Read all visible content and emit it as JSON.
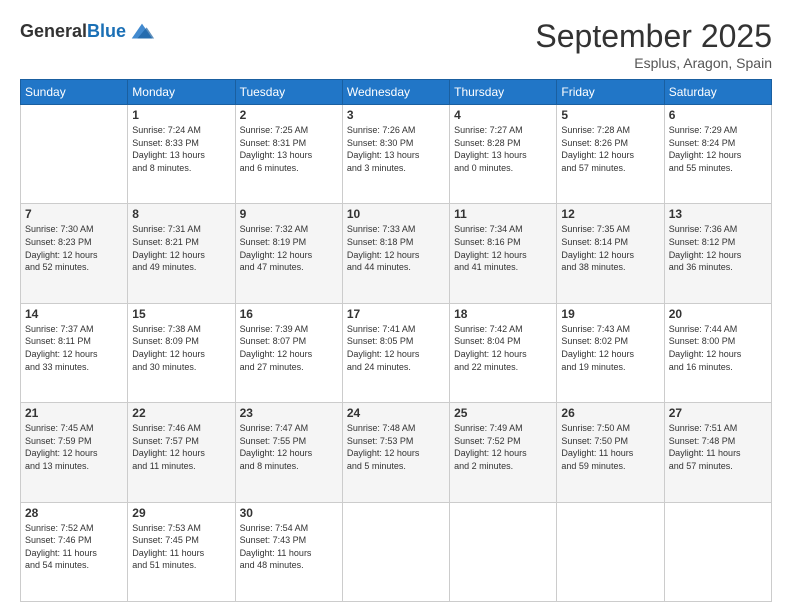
{
  "header": {
    "logo_general": "General",
    "logo_blue": "Blue",
    "month": "September 2025",
    "location": "Esplus, Aragon, Spain"
  },
  "weekdays": [
    "Sunday",
    "Monday",
    "Tuesday",
    "Wednesday",
    "Thursday",
    "Friday",
    "Saturday"
  ],
  "weeks": [
    [
      {
        "day": "",
        "text": ""
      },
      {
        "day": "1",
        "text": "Sunrise: 7:24 AM\nSunset: 8:33 PM\nDaylight: 13 hours\nand 8 minutes."
      },
      {
        "day": "2",
        "text": "Sunrise: 7:25 AM\nSunset: 8:31 PM\nDaylight: 13 hours\nand 6 minutes."
      },
      {
        "day": "3",
        "text": "Sunrise: 7:26 AM\nSunset: 8:30 PM\nDaylight: 13 hours\nand 3 minutes."
      },
      {
        "day": "4",
        "text": "Sunrise: 7:27 AM\nSunset: 8:28 PM\nDaylight: 13 hours\nand 0 minutes."
      },
      {
        "day": "5",
        "text": "Sunrise: 7:28 AM\nSunset: 8:26 PM\nDaylight: 12 hours\nand 57 minutes."
      },
      {
        "day": "6",
        "text": "Sunrise: 7:29 AM\nSunset: 8:24 PM\nDaylight: 12 hours\nand 55 minutes."
      }
    ],
    [
      {
        "day": "7",
        "text": "Sunrise: 7:30 AM\nSunset: 8:23 PM\nDaylight: 12 hours\nand 52 minutes."
      },
      {
        "day": "8",
        "text": "Sunrise: 7:31 AM\nSunset: 8:21 PM\nDaylight: 12 hours\nand 49 minutes."
      },
      {
        "day": "9",
        "text": "Sunrise: 7:32 AM\nSunset: 8:19 PM\nDaylight: 12 hours\nand 47 minutes."
      },
      {
        "day": "10",
        "text": "Sunrise: 7:33 AM\nSunset: 8:18 PM\nDaylight: 12 hours\nand 44 minutes."
      },
      {
        "day": "11",
        "text": "Sunrise: 7:34 AM\nSunset: 8:16 PM\nDaylight: 12 hours\nand 41 minutes."
      },
      {
        "day": "12",
        "text": "Sunrise: 7:35 AM\nSunset: 8:14 PM\nDaylight: 12 hours\nand 38 minutes."
      },
      {
        "day": "13",
        "text": "Sunrise: 7:36 AM\nSunset: 8:12 PM\nDaylight: 12 hours\nand 36 minutes."
      }
    ],
    [
      {
        "day": "14",
        "text": "Sunrise: 7:37 AM\nSunset: 8:11 PM\nDaylight: 12 hours\nand 33 minutes."
      },
      {
        "day": "15",
        "text": "Sunrise: 7:38 AM\nSunset: 8:09 PM\nDaylight: 12 hours\nand 30 minutes."
      },
      {
        "day": "16",
        "text": "Sunrise: 7:39 AM\nSunset: 8:07 PM\nDaylight: 12 hours\nand 27 minutes."
      },
      {
        "day": "17",
        "text": "Sunrise: 7:41 AM\nSunset: 8:05 PM\nDaylight: 12 hours\nand 24 minutes."
      },
      {
        "day": "18",
        "text": "Sunrise: 7:42 AM\nSunset: 8:04 PM\nDaylight: 12 hours\nand 22 minutes."
      },
      {
        "day": "19",
        "text": "Sunrise: 7:43 AM\nSunset: 8:02 PM\nDaylight: 12 hours\nand 19 minutes."
      },
      {
        "day": "20",
        "text": "Sunrise: 7:44 AM\nSunset: 8:00 PM\nDaylight: 12 hours\nand 16 minutes."
      }
    ],
    [
      {
        "day": "21",
        "text": "Sunrise: 7:45 AM\nSunset: 7:59 PM\nDaylight: 12 hours\nand 13 minutes."
      },
      {
        "day": "22",
        "text": "Sunrise: 7:46 AM\nSunset: 7:57 PM\nDaylight: 12 hours\nand 11 minutes."
      },
      {
        "day": "23",
        "text": "Sunrise: 7:47 AM\nSunset: 7:55 PM\nDaylight: 12 hours\nand 8 minutes."
      },
      {
        "day": "24",
        "text": "Sunrise: 7:48 AM\nSunset: 7:53 PM\nDaylight: 12 hours\nand 5 minutes."
      },
      {
        "day": "25",
        "text": "Sunrise: 7:49 AM\nSunset: 7:52 PM\nDaylight: 12 hours\nand 2 minutes."
      },
      {
        "day": "26",
        "text": "Sunrise: 7:50 AM\nSunset: 7:50 PM\nDaylight: 11 hours\nand 59 minutes."
      },
      {
        "day": "27",
        "text": "Sunrise: 7:51 AM\nSunset: 7:48 PM\nDaylight: 11 hours\nand 57 minutes."
      }
    ],
    [
      {
        "day": "28",
        "text": "Sunrise: 7:52 AM\nSunset: 7:46 PM\nDaylight: 11 hours\nand 54 minutes."
      },
      {
        "day": "29",
        "text": "Sunrise: 7:53 AM\nSunset: 7:45 PM\nDaylight: 11 hours\nand 51 minutes."
      },
      {
        "day": "30",
        "text": "Sunrise: 7:54 AM\nSunset: 7:43 PM\nDaylight: 11 hours\nand 48 minutes."
      },
      {
        "day": "",
        "text": ""
      },
      {
        "day": "",
        "text": ""
      },
      {
        "day": "",
        "text": ""
      },
      {
        "day": "",
        "text": ""
      }
    ]
  ]
}
